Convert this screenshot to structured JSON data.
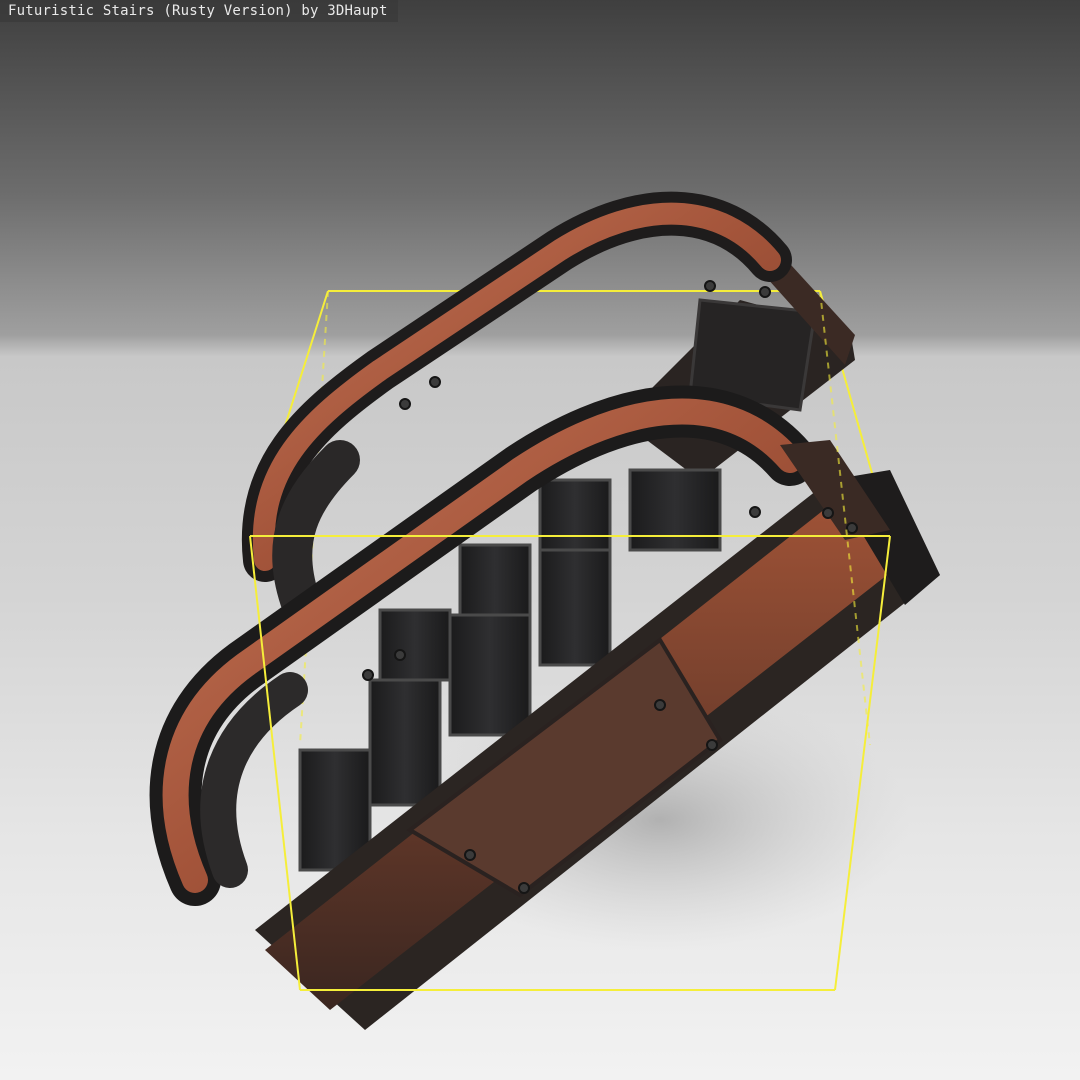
{
  "viewer": {
    "title": "Futuristic Stairs (Rusty Version) by 3DHaupt",
    "bounding_box_visible": true,
    "bounding_box_color": "#f5ee3a",
    "model_colors": {
      "rust": "#a9583a",
      "dark_metal": "#2c2826",
      "steel": "#1f1f20"
    }
  }
}
